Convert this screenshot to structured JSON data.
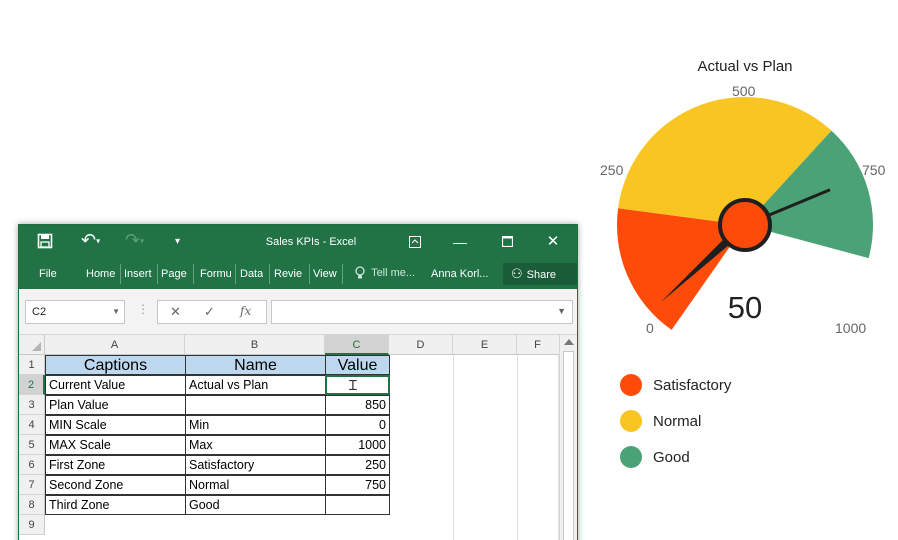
{
  "excel": {
    "title": "Sales KPIs - Excel",
    "tabs": [
      "File",
      "Home",
      "Insert",
      "Page",
      "Formu",
      "Data",
      "Revie",
      "View"
    ],
    "tell_me": "Tell me...",
    "user": "Anna Korl...",
    "share_label": "Share",
    "name_box": "C2",
    "formula_content": "",
    "columns": [
      "A",
      "B",
      "C",
      "D",
      "E",
      "F"
    ],
    "rows": [
      "1",
      "2",
      "3",
      "4",
      "5",
      "6",
      "7",
      "8",
      "9"
    ],
    "table": {
      "headers": [
        "Captions",
        "Name",
        "Value"
      ],
      "rows": [
        [
          "Current Value",
          "Actual vs Plan",
          ""
        ],
        [
          "Plan Value",
          "",
          "850"
        ],
        [
          "MIN Scale",
          "Min",
          "0"
        ],
        [
          "MAX Scale",
          "Max",
          "1000"
        ],
        [
          "First Zone",
          "Satisfactory",
          "250"
        ],
        [
          "Second Zone",
          "Normal",
          "750"
        ],
        [
          "Third Zone",
          "Good",
          ""
        ]
      ]
    }
  },
  "gauge": {
    "title": "Actual vs Plan",
    "value_display": "50",
    "value": 50,
    "plan": 850,
    "min": 0,
    "max": 1000,
    "ticks": [
      "0",
      "250",
      "500",
      "750",
      "1000"
    ],
    "zones": [
      {
        "name": "Satisfactory",
        "from": 0,
        "to": 250,
        "color": "#ff4b0a"
      },
      {
        "name": "Normal",
        "from": 250,
        "to": 750,
        "color": "#f8c522"
      },
      {
        "name": "Good",
        "from": 750,
        "to": 1000,
        "color": "#4aa276"
      }
    ],
    "needle_color": "#1f1f1f"
  },
  "chart_data": {
    "type": "gauge",
    "title": "Actual vs Plan",
    "value": 50,
    "target": 850,
    "range": [
      0,
      1000
    ],
    "bands": [
      {
        "label": "Satisfactory",
        "from": 0,
        "to": 250
      },
      {
        "label": "Normal",
        "from": 250,
        "to": 750
      },
      {
        "label": "Good",
        "from": 750,
        "to": 1000
      }
    ],
    "tick_labels": [
      "0",
      "250",
      "500",
      "750",
      "1000"
    ]
  }
}
